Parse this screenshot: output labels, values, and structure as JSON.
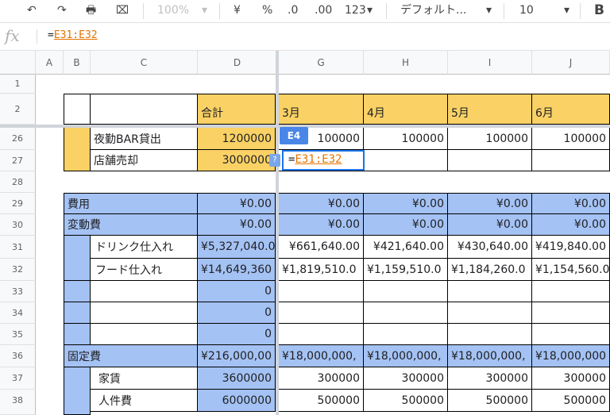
{
  "toolbar": {
    "undo": "↶",
    "redo": "↷",
    "print": "🖶",
    "paint": "⌧",
    "zoom": "100%",
    "zoom_arrow": "▾",
    "currency": "¥",
    "percent": "%",
    "dec_less": ".0",
    "dec_more": ".00",
    "number_format": "123",
    "number_format_arrow": "▾",
    "font": "デフォルト...",
    "font_arrow": "▾",
    "font_size": "10",
    "font_size_arrow": "▾",
    "bold": "B"
  },
  "formula_bar": {
    "fx": "fx",
    "eq": "=",
    "ref": "E31:E32"
  },
  "columns": [
    "A",
    "B",
    "C",
    "D",
    "G",
    "H",
    "I",
    "J"
  ],
  "rows": {
    "r1": "1",
    "r2": "2",
    "r26": "26",
    "r27": "27",
    "r28": "28",
    "r29": "29",
    "r30": "30",
    "r31": "31",
    "r32": "32",
    "r33": "33",
    "r34": "34",
    "r35": "35",
    "r36": "36",
    "r37": "37",
    "r38": "38"
  },
  "cells": {
    "d2": "合計",
    "g2": "3月",
    "h2": "4月",
    "i2": "5月",
    "j2": "6月",
    "c26": "夜勤BAR貸出",
    "d26": "1200000",
    "g26": "100000",
    "h26": "100000",
    "i26": "100000",
    "j26": "100000",
    "c27": "店舗売却",
    "d27": "3000000",
    "b29": "費用",
    "d29": "¥0.00",
    "g29": "¥0.00",
    "h29": "¥0.00",
    "i29": "¥0.00",
    "j29": "¥0.00",
    "b30": "変動費",
    "d30": "¥0.00",
    "g30": "¥0.00",
    "h30": "¥0.00",
    "i30": "¥0.00",
    "j30": "¥0.00",
    "c31": "ドリンク仕入れ",
    "d31": "¥5,327,040.0",
    "g31": "¥661,640.00",
    "h31": "¥421,640.00",
    "i31": "¥430,640.00",
    "j31": "¥419,840.00",
    "c32": "フード仕入れ",
    "d32": "¥14,649,360",
    "g32": "¥1,819,510.0",
    "h32": "¥1,159,510.0",
    "i32": "¥1,184,260.0",
    "j32": "¥1,154,560.0",
    "d33": "0",
    "d34": "0",
    "d35": "0",
    "b36": "固定費",
    "d36": "¥216,000,00",
    "g36": "¥18,000,000,",
    "h36": "¥18,000,000,",
    "i36": "¥18,000,000,",
    "j36": "¥18,000,000",
    "c37": "家賃",
    "d37": "3600000",
    "g37": "300000",
    "h37": "300000",
    "i37": "300000",
    "j37": "300000",
    "c38": "人件費",
    "d38": "6000000",
    "g38": "500000",
    "h38": "500000",
    "i38": "500000",
    "j38": "500000"
  },
  "active_cell_tag": "E4",
  "help_badge": "?",
  "editor": {
    "eq": "=",
    "ref": "E31:E32"
  },
  "colors": {
    "yellow": "#fad165",
    "blue": "#a4c2f4",
    "selection": "#1a73e8",
    "ref": "#e37400"
  }
}
